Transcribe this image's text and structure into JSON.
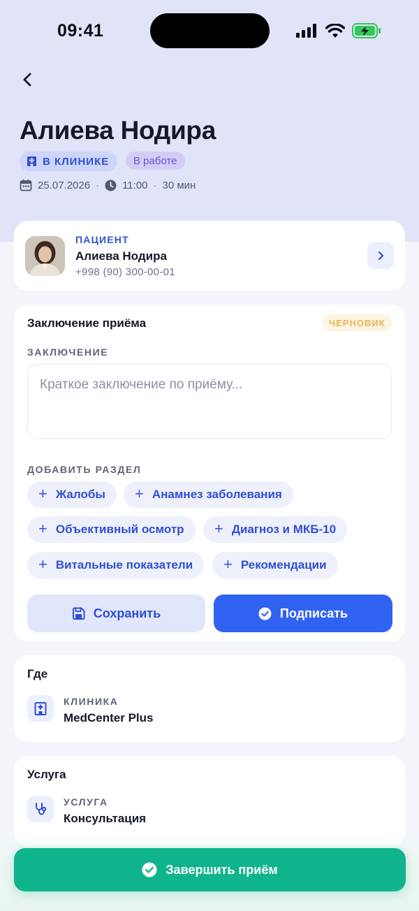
{
  "status_bar": {
    "time": "09:41"
  },
  "header": {
    "title": "Алиева Нодира",
    "location_chip": "В КЛИНИКЕ",
    "status_chip": "В работе",
    "date": "25.07.2026",
    "time": "11:00",
    "duration": "30 мин",
    "separator": "·"
  },
  "patient": {
    "label": "ПАЦИЕНТ",
    "name": "Алиева Нодира",
    "phone": "+998 (90) 300-00-01"
  },
  "conclusion": {
    "title": "Заключение приёма",
    "badge": "ЧЕРНОВИК",
    "field_label": "ЗАКЛЮЧЕНИЕ",
    "placeholder": "Краткое заключение по приёму...",
    "add_section_label": "ДОБАВИТЬ РАЗДЕЛ",
    "sections": [
      "Жалобы",
      "Анамнез заболевания",
      "Объективный осмотр",
      "Диагноз и МКБ-10",
      "Витальные показатели",
      "Рекомендации"
    ],
    "plus": "+",
    "save_label": "Сохранить",
    "sign_label": "Подписать"
  },
  "where": {
    "title": "Где",
    "label": "КЛИНИКА",
    "value": "MedCenter Plus"
  },
  "service": {
    "title": "Услуга",
    "label": "УСЛУГА",
    "value": "Консультация"
  },
  "footer": {
    "finish_label": "Завершить приём"
  },
  "colors": {
    "primary": "#3163f2",
    "accent_green": "#0fb48c",
    "header_bg": "#e1e3f8",
    "draft": "#e9b457"
  }
}
